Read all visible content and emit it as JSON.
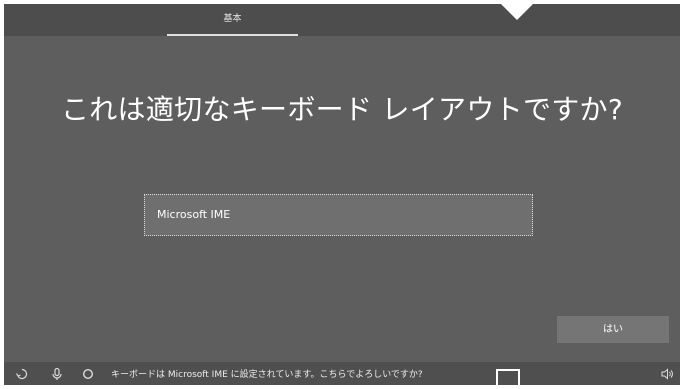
{
  "header": {
    "tab_label": "基本"
  },
  "main": {
    "title": "これは適切なキーボード レイアウトですか?",
    "keyboard_options": [
      "Microsoft IME"
    ]
  },
  "actions": {
    "yes_label": "はい"
  },
  "taskbar": {
    "status_text": "キーボードは Microsoft IME に設定されています。こちらでよろしいですか?",
    "icons": [
      "accessibility-icon",
      "microphone-icon",
      "cortana-icon",
      "volume-icon"
    ]
  }
}
